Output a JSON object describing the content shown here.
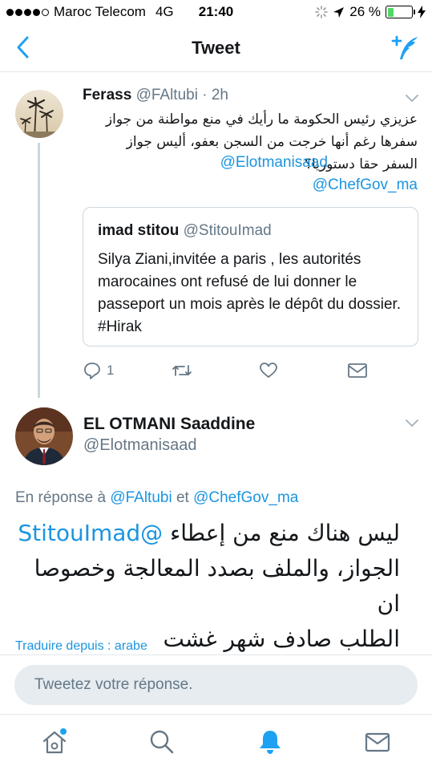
{
  "status_bar": {
    "carrier": "Maroc Telecom",
    "network": "4G",
    "time": "21:40",
    "battery": "26 %",
    "battery_level": 0.26,
    "signal_bars_filled": 4,
    "signal_bars_total": 5
  },
  "nav": {
    "title": "Tweet",
    "back_icon": "chevron-left-icon",
    "compose_icon": "compose-tweet-icon"
  },
  "tweet1": {
    "name": "Ferass",
    "handle": "@FAltubi",
    "time": "· 2h",
    "text_line1": "عزيزي رئيس الحكومة ما رأيك في منع مواطنة  من جواز",
    "text_line2": "سفرها رغم أنها خرجت من السجن بعفو، أليس جواز",
    "text_line3": "السفر حقا دستوريا؟",
    "mention1": "@Elotmanisaad",
    "mention2": "@ChefGov_ma",
    "quote": {
      "name": "imad stitou",
      "handle": "@StitouImad",
      "text": "Silya Ziani,invitée a paris , les autorités marocaines ont refusé de lui donner le passeport un mois après le dépôt du dossier.",
      "hashtag": "#Hirak"
    },
    "reply_count": "1",
    "icons": [
      "reply-icon",
      "retweet-icon",
      "like-icon",
      "direct-message-icon"
    ]
  },
  "tweet2": {
    "name": "EL OTMANI Saaddine",
    "handle": "@Elotmanisaad",
    "reply_prefix": "En réponse à",
    "reply_user1": "@FAltubi",
    "reply_and": "et",
    "reply_user2": "@ChefGov_ma",
    "mention": "@StitouImad",
    "text_line1": "ليس هناك منع من إعطاء",
    "text_line2": "الجواز، والملف بصدد المعالجة وخصوصا ان",
    "text_line3": "الطلب صادف شهر غشت",
    "translate": "Traduire depuis : arabe"
  },
  "reply_box": {
    "placeholder": "Tweetez votre réponse."
  },
  "tabbar": {
    "items": [
      "home-icon",
      "search-icon",
      "notifications-icon",
      "messages-icon"
    ],
    "active": "notifications-icon",
    "accent": "#1da1f2"
  },
  "colors": {
    "accent": "#1da1f2",
    "link": "#1b95e0",
    "secondary": "#657786",
    "text": "#14171a",
    "battery": "#4cd964"
  }
}
